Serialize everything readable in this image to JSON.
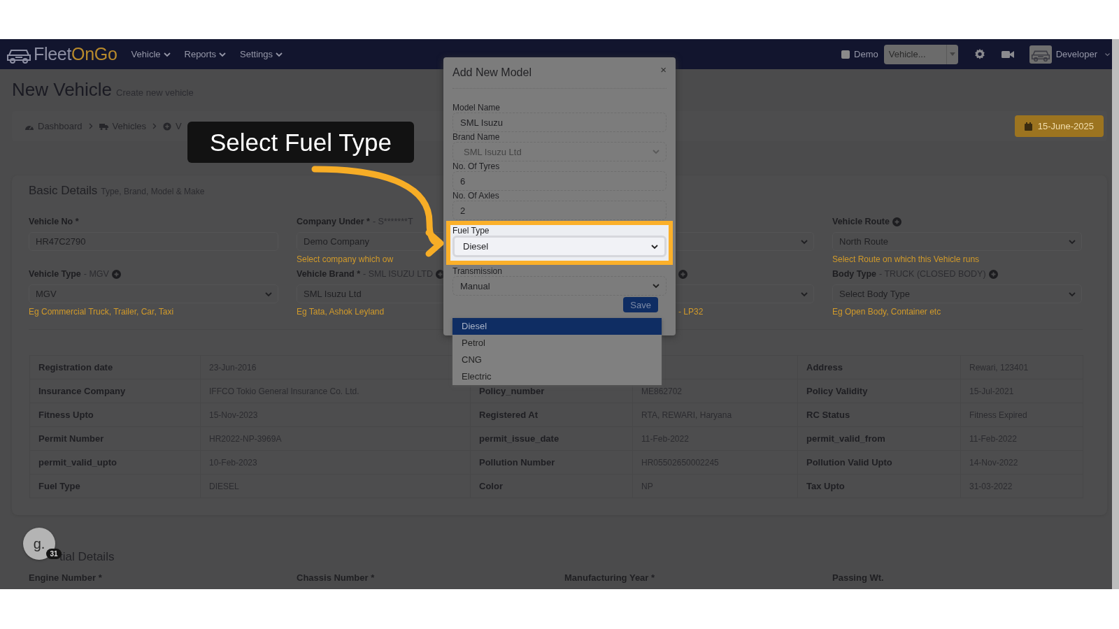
{
  "navbar": {
    "logo": {
      "part_1": "Fleet",
      "part_2": "OnGo"
    },
    "menus": [
      {
        "label": "Vehicle"
      },
      {
        "label": "Reports"
      },
      {
        "label": "Settings"
      }
    ],
    "demo": {
      "label": "Demo",
      "checked": false
    },
    "vehicle_select": {
      "value": "Vehicle..."
    },
    "user": {
      "name": "Developer"
    }
  },
  "page": {
    "title": "New Vehicle",
    "subtitle": "Create new vehicle",
    "breadcrumbs": [
      {
        "label": "Dashboard",
        "kind": "gauge"
      },
      {
        "label": "Vehicles",
        "kind": "truck"
      },
      {
        "label": "V",
        "kind": "plus"
      }
    ],
    "date": "15-June-2025"
  },
  "basic_details": {
    "title": "Basic Details",
    "subtitle": "Type, Brand, Model & Make",
    "fields": [
      {
        "label": "Vehicle No *",
        "kind": "input",
        "value": "HR47C2790",
        "add_icon": false
      },
      {
        "label": "Company Under *",
        "note": "- S*******T",
        "kind": "input",
        "value": "Demo Company",
        "helper": "Select company which ow",
        "add_icon": false
      },
      {
        "kind": "select",
        "add_icon": false
      },
      {
        "label": "Vehicle Route",
        "kind": "select",
        "value": "North Route",
        "helper": "Select Route on which this Vehicle runs",
        "add_icon": true
      },
      {
        "label": "Vehicle Type",
        "note": "- MGV",
        "kind": "select",
        "value": "MGV",
        "helper": "Eg Commercial Truck, Trailer, Car, Taxi",
        "add_icon": true
      },
      {
        "label": "Vehicle Brand *",
        "note": "- SML ISUZU LTD",
        "kind": "input",
        "value": "SML Isuzu Ltd",
        "helper": "Eg Tata, Ashok Leyland",
        "add_icon": true
      },
      {
        "kind": "select",
        "helper": "- LP32",
        "add_icon": true
      },
      {
        "label": "Body Type",
        "note": "- TRUCK (CLOSED BODY)",
        "kind": "select",
        "value": "Select Body Type",
        "helper": "Eg Open Body, Container etc",
        "add_icon": true
      }
    ]
  },
  "details_table": {
    "rows": [
      [
        "Registration date",
        "23-Jun-2016",
        null,
        null,
        "Address",
        "Rewari, 123401"
      ],
      [
        "Insurance Company",
        "IFFCO Tokio General Insurance Co. Ltd.",
        "Policy_number",
        "ME862702",
        "Policy Validity",
        "15-Jul-2021"
      ],
      [
        "Fitness Upto",
        "15-Nov-2023",
        "Registered At",
        "RTA, REWARI, Haryana",
        "RC Status",
        "Fitness Expired"
      ],
      [
        "Permit Number",
        "HR2022-NP-3969A",
        "permit_issue_date",
        "11-Feb-2022",
        "permit_valid_from",
        "11-Feb-2022"
      ],
      [
        "permit_valid_upto",
        "10-Feb-2023",
        "Pollution Number",
        "HR05502650002245",
        "Pollution Valid Upto",
        "14-Nov-2022"
      ],
      [
        "Fuel Type",
        "DIESEL",
        "Color",
        "NP",
        "Tax Upto",
        "31-03-2022"
      ]
    ]
  },
  "next_section": {
    "title": "tial Details",
    "fields": [
      "Engine Number *",
      "Chassis Number *",
      "Manufacturing Year *",
      "Passing Wt."
    ]
  },
  "modal": {
    "title": "Add New Model",
    "close": "×",
    "fields": [
      {
        "label": "Model Name",
        "kind": "input",
        "value": "SML Isuzu",
        "disabled": false,
        "highlighted": false
      },
      {
        "label": "Brand Name",
        "kind": "select",
        "value": "SML Isuzu Ltd",
        "disabled": true,
        "highlighted": false
      },
      {
        "label": "No. Of Tyres",
        "kind": "input",
        "value": "6",
        "disabled": false,
        "highlighted": false
      },
      {
        "label": "No. Of Axles",
        "kind": "input",
        "value": "2",
        "disabled": false,
        "highlighted": false
      },
      {
        "label": "Fuel Type",
        "kind": "select",
        "value": "Diesel",
        "disabled": false,
        "highlighted": true
      },
      {
        "label": "Transmission",
        "kind": "select",
        "value": "Manual",
        "disabled": false,
        "highlighted": false
      }
    ],
    "save": "Save",
    "dropdown": [
      {
        "label": "Diesel",
        "selected": true
      },
      {
        "label": "Petrol",
        "selected": false
      },
      {
        "label": "CNG",
        "selected": false
      },
      {
        "label": "Electric",
        "selected": false
      }
    ]
  },
  "tour": {
    "tooltip": "Select Fuel Type"
  },
  "guide_badge": {
    "letter": "g.",
    "count": "31"
  }
}
